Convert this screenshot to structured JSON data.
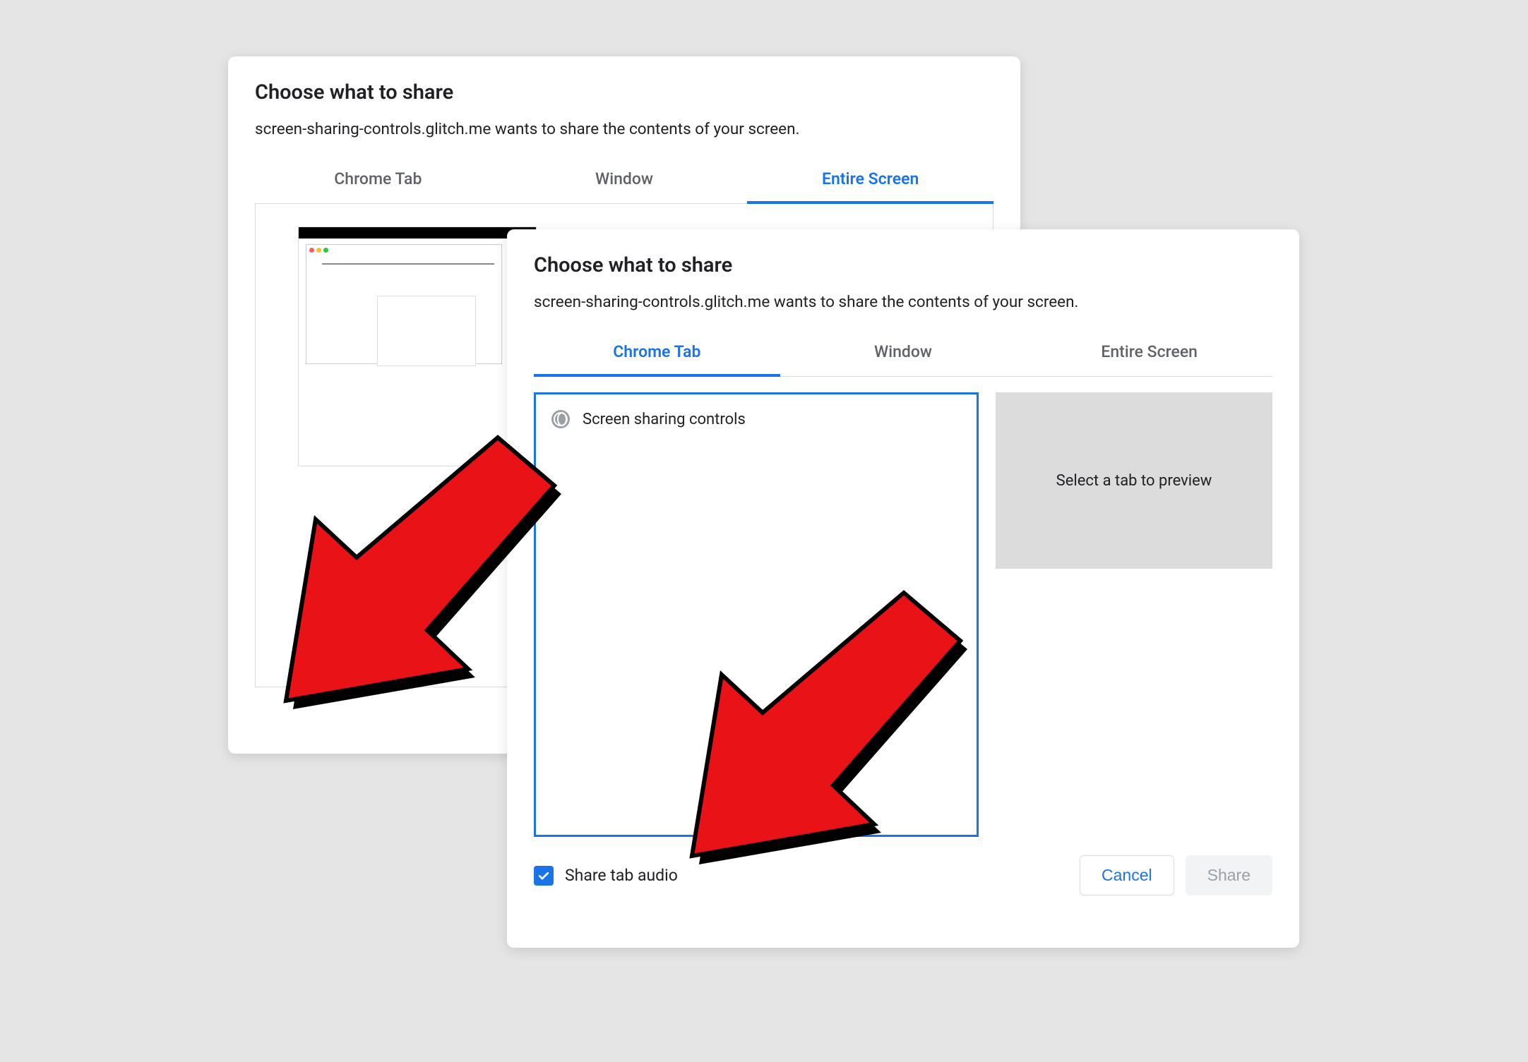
{
  "dialog_back": {
    "title": "Choose what to share",
    "subtitle": "screen-sharing-controls.glitch.me wants to share the contents of your screen.",
    "tabs": [
      {
        "label": "Chrome Tab",
        "active": false
      },
      {
        "label": "Window",
        "active": false
      },
      {
        "label": "Entire Screen",
        "active": true
      }
    ]
  },
  "dialog_front": {
    "title": "Choose what to share",
    "subtitle": "screen-sharing-controls.glitch.me wants to share the contents of your screen.",
    "tabs": [
      {
        "label": "Chrome Tab",
        "active": true
      },
      {
        "label": "Window",
        "active": false
      },
      {
        "label": "Entire Screen",
        "active": false
      }
    ],
    "tab_items": [
      {
        "icon": "globe-icon",
        "label": "Screen sharing controls"
      }
    ],
    "preview_placeholder": "Select a tab to preview",
    "share_audio_label": "Share tab audio",
    "share_audio_checked": true,
    "buttons": {
      "cancel": "Cancel",
      "share": "Share"
    }
  }
}
